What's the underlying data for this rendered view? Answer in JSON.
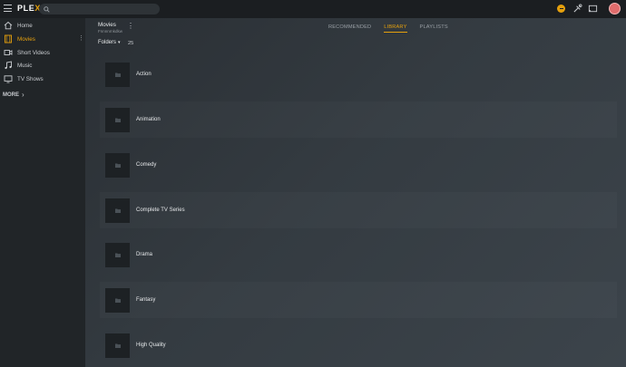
{
  "app": {
    "logo_main": "PLE",
    "logo_accent": "X"
  },
  "search": {
    "placeholder": ""
  },
  "topbar_icons": [
    "activity-icon",
    "tools-icon",
    "cast-icon",
    "avatar"
  ],
  "sidebar": {
    "items": [
      {
        "label": "Home",
        "icon": "home-icon"
      },
      {
        "label": "Movies",
        "icon": "film-icon",
        "active": true
      },
      {
        "label": "Short Videos",
        "icon": "video-icon"
      },
      {
        "label": "Music",
        "icon": "music-icon"
      },
      {
        "label": "TV Shows",
        "icon": "tv-icon"
      }
    ],
    "more_label": "MORE"
  },
  "library": {
    "title": "Movies",
    "subtitle": "Fnnnnrnkdkw",
    "folders_label": "Folders",
    "count": "25"
  },
  "tabs": [
    {
      "label": "RECOMMENDED",
      "active": false
    },
    {
      "label": "LIBRARY",
      "active": true
    },
    {
      "label": "PLAYLISTS",
      "active": false
    }
  ],
  "folders": [
    {
      "label": "Action"
    },
    {
      "label": "Animation"
    },
    {
      "label": "Comedy"
    },
    {
      "label": "Complete TV Series"
    },
    {
      "label": "Drama"
    },
    {
      "label": "Fantasy"
    },
    {
      "label": "High Quality"
    }
  ],
  "colors": {
    "accent": "#e5a00d",
    "sidebar_bg": "#212528",
    "topbar_bg": "#1b1e21"
  }
}
